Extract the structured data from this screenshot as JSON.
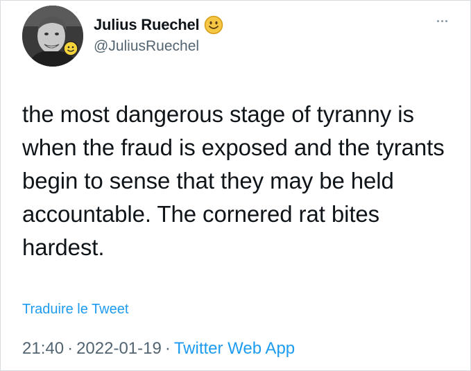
{
  "tweet": {
    "display_name": "Julius Ruechel",
    "name_emoji": "smiley-face-emoji",
    "handle": "@JuliusRuechel",
    "text": "the most dangerous stage of tyranny is when the fraud is exposed and the tyrants begin to sense that they may be held accountable. The cornered rat bites hardest.",
    "translate_label": "Traduire le Tweet",
    "time": "21:40",
    "separator": "·",
    "date": "2022-01-19",
    "source": "Twitter Web App"
  },
  "icons": {
    "more": "more-horizontal-icon",
    "avatar": "profile-photo"
  },
  "colors": {
    "link": "#1d9bf0",
    "secondary_text": "#536471",
    "primary_text": "#0f1419",
    "emoji_yellow": "#f6c744"
  }
}
